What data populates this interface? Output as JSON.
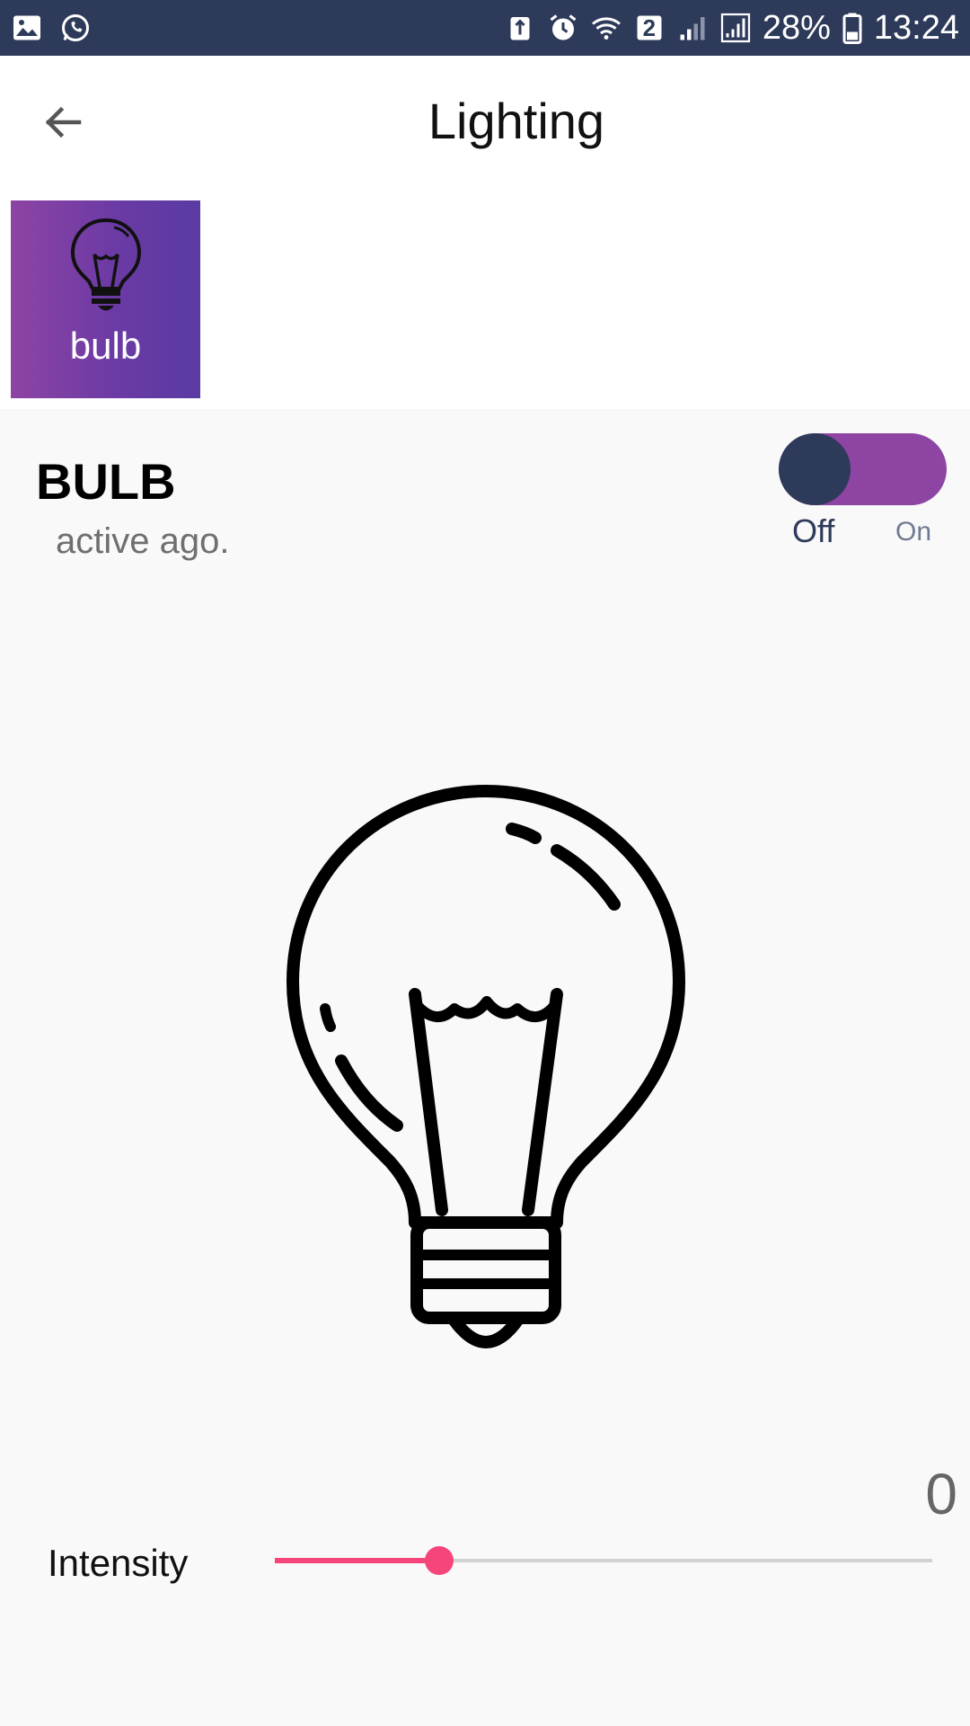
{
  "status_bar": {
    "battery_percent": "28%",
    "time": "13:24",
    "notification_badge": "2",
    "icons_left": [
      "gallery-icon",
      "whatsapp-icon"
    ],
    "icons_right": [
      "usb-debug-icon",
      "alarm-icon",
      "wifi-icon",
      "sim-badge-icon",
      "signal-icon",
      "signal-icon",
      "battery-icon"
    ]
  },
  "app_bar": {
    "title": "Lighting",
    "back_icon": "arrow-left-icon"
  },
  "devices": [
    {
      "label": "bulb",
      "icon": "lightbulb-icon",
      "selected": true
    }
  ],
  "device_panel": {
    "name": "BULB",
    "status": "active ago.",
    "toggle": {
      "off_label": "Off",
      "on_label": "On",
      "state": "off"
    },
    "illustration": "lightbulb-icon",
    "intensity": {
      "label": "Intensity",
      "value": "0",
      "slider_fraction": 0.25
    }
  },
  "colors": {
    "status_bar": "#2e3a5a",
    "tile_gradient_start": "#8e44a3",
    "tile_gradient_end": "#5a3aa3",
    "toggle_track": "#8e44a3",
    "toggle_knob": "#2e3a5a",
    "slider_accent": "#f5457a"
  }
}
